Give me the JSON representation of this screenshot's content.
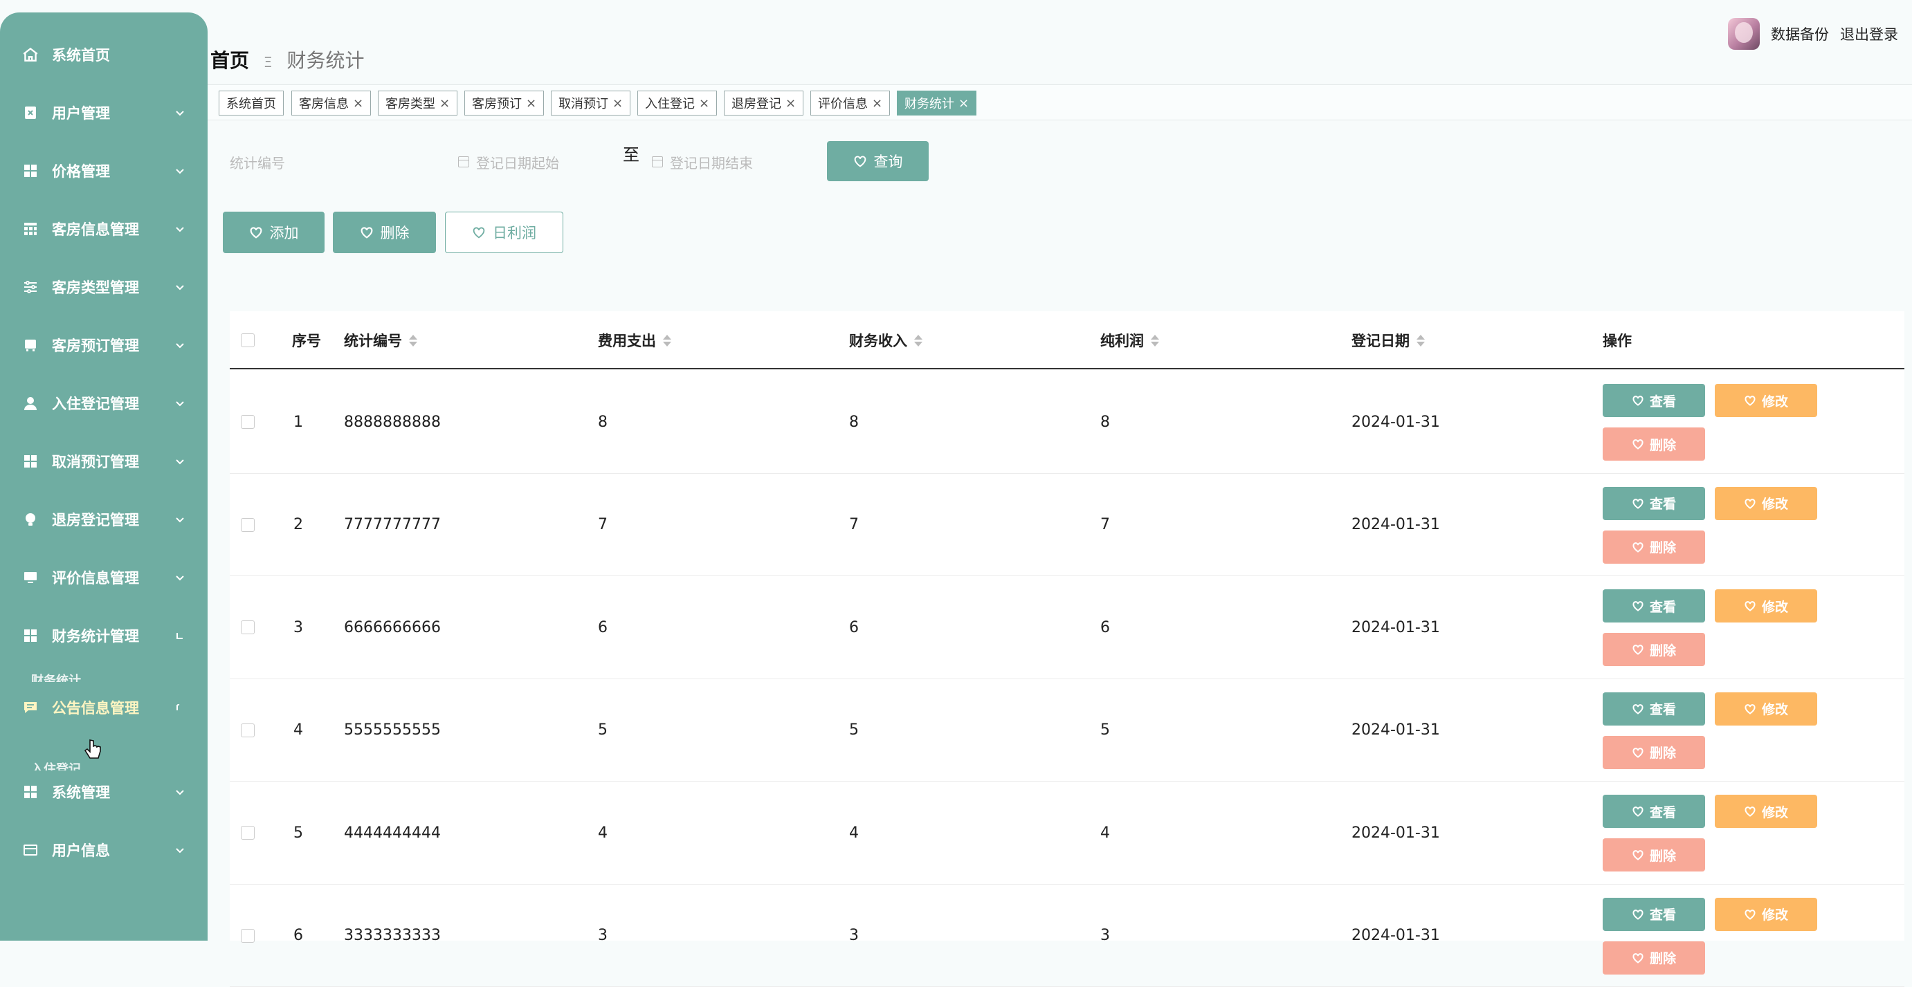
{
  "sidebar": {
    "items": [
      {
        "label": "系统首页",
        "icon": "home-icon"
      },
      {
        "label": "用户管理",
        "icon": "user-manage-icon"
      },
      {
        "label": "价格管理",
        "icon": "grid-icon"
      },
      {
        "label": "客房信息管理",
        "icon": "table-icon"
      },
      {
        "label": "客房类型管理",
        "icon": "sliders-icon"
      },
      {
        "label": "客房预订管理",
        "icon": "bed-icon"
      },
      {
        "label": "入住登记管理",
        "icon": "person-icon"
      },
      {
        "label": "取消预订管理",
        "icon": "grid-icon"
      },
      {
        "label": "退房登记管理",
        "icon": "bulb-icon"
      },
      {
        "label": "评价信息管理",
        "icon": "monitor-icon"
      },
      {
        "label": "财务统计管理",
        "icon": "grid-icon"
      },
      {
        "label": "公告信息管理",
        "icon": "chat-icon"
      },
      {
        "label": "系统管理",
        "icon": "grid-icon"
      },
      {
        "label": "用户信息",
        "icon": "card-icon"
      }
    ],
    "ghost_sub_1": "财务统计",
    "ghost_sub_2": "入住登记"
  },
  "breadcrumb": {
    "home": "首页",
    "separator": "Ξ",
    "current": "财务统计"
  },
  "header": {
    "backup": "数据备份",
    "logout": "退出登录"
  },
  "tabs": [
    {
      "label": "系统首页",
      "closable": false
    },
    {
      "label": "客房信息",
      "closable": true
    },
    {
      "label": "客房类型",
      "closable": true
    },
    {
      "label": "客房预订",
      "closable": true
    },
    {
      "label": "取消预订",
      "closable": true
    },
    {
      "label": "入住登记",
      "closable": true
    },
    {
      "label": "退房登记",
      "closable": true
    },
    {
      "label": "评价信息",
      "closable": true
    },
    {
      "label": "财务统计",
      "closable": true,
      "active": true
    }
  ],
  "search": {
    "code_placeholder": "统计编号",
    "date_start_placeholder": "登记日期起始",
    "to": "至",
    "date_end_placeholder": "登记日期结束",
    "query": "查询"
  },
  "toolbar": {
    "add": "添加",
    "delete": "删除",
    "daily_profit": "日利润"
  },
  "table": {
    "headers": {
      "index": "序号",
      "code": "统计编号",
      "expense": "费用支出",
      "income": "财务收入",
      "profit": "纯利润",
      "date": "登记日期",
      "actions": "操作"
    },
    "rows": [
      {
        "index": "1",
        "code": "8888888888",
        "expense": "8",
        "income": "8",
        "profit": "8",
        "date": "2024-01-31"
      },
      {
        "index": "2",
        "code": "7777777777",
        "expense": "7",
        "income": "7",
        "profit": "7",
        "date": "2024-01-31"
      },
      {
        "index": "3",
        "code": "6666666666",
        "expense": "6",
        "income": "6",
        "profit": "6",
        "date": "2024-01-31"
      },
      {
        "index": "4",
        "code": "5555555555",
        "expense": "5",
        "income": "5",
        "profit": "5",
        "date": "2024-01-31"
      },
      {
        "index": "5",
        "code": "4444444444",
        "expense": "4",
        "income": "4",
        "profit": "4",
        "date": "2024-01-31"
      },
      {
        "index": "6",
        "code": "3333333333",
        "expense": "3",
        "income": "3",
        "profit": "3",
        "date": "2024-01-31"
      }
    ],
    "action_view": "查看",
    "action_edit": "修改",
    "action_delete": "删除"
  },
  "colors": {
    "primary": "#6fada2",
    "edit": "#fdb863",
    "delete": "#f8a998",
    "active_menu_text": "#fff5c2"
  }
}
